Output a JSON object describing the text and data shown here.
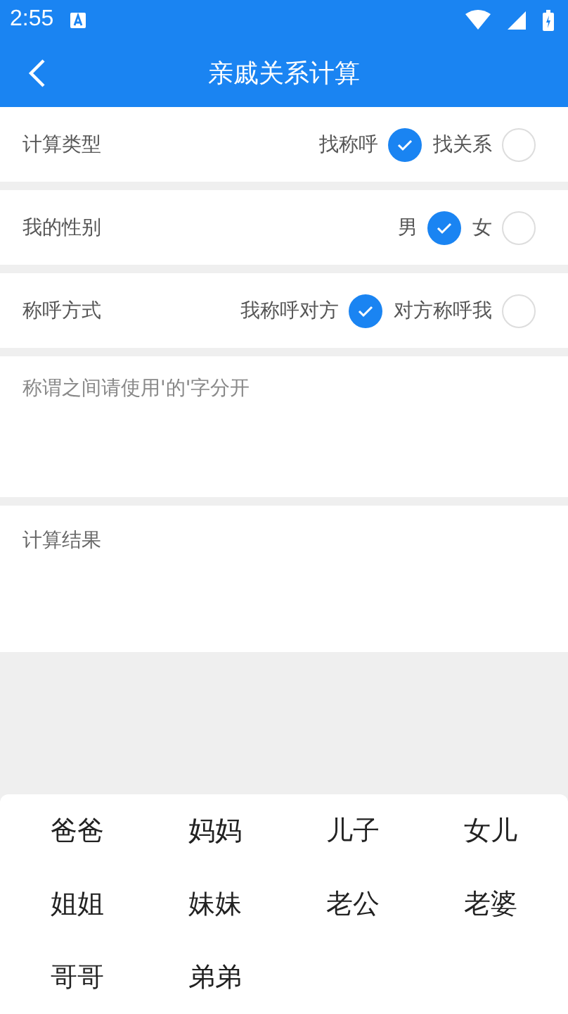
{
  "status_bar": {
    "time": "2:55"
  },
  "app_bar": {
    "title": "亲戚关系计算"
  },
  "settings": [
    {
      "label": "计算类型",
      "options": [
        {
          "label": "找称呼",
          "selected": true
        },
        {
          "label": "找关系",
          "selected": false
        }
      ]
    },
    {
      "label": "我的性别",
      "options": [
        {
          "label": "男",
          "selected": true
        },
        {
          "label": "女",
          "selected": false
        }
      ]
    },
    {
      "label": "称呼方式",
      "options": [
        {
          "label": "我称呼对方",
          "selected": true
        },
        {
          "label": "对方称呼我",
          "selected": false
        }
      ]
    }
  ],
  "input": {
    "placeholder": "称谓之间请使用'的'字分开"
  },
  "result": {
    "label": "计算结果"
  },
  "keys": [
    "爸爸",
    "妈妈",
    "儿子",
    "女儿",
    "姐姐",
    "妹妹",
    "老公",
    "老婆",
    "哥哥",
    "弟弟"
  ]
}
